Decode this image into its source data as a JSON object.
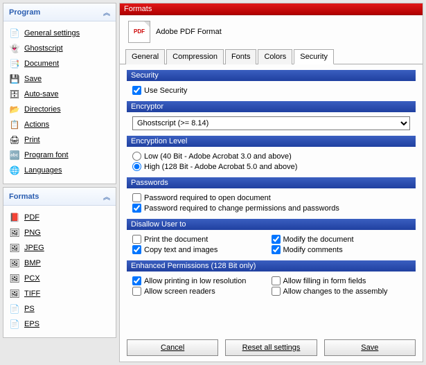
{
  "sidebar": {
    "program": {
      "title": "Program",
      "items": [
        {
          "label": "General settings",
          "icon": "📄"
        },
        {
          "label": "Ghostscript",
          "icon": "👻"
        },
        {
          "label": "Document",
          "icon": "📑"
        },
        {
          "label": "Save",
          "icon": "💾"
        },
        {
          "label": "Auto-save",
          "icon": "🗄"
        },
        {
          "label": "Directories",
          "icon": "📂"
        },
        {
          "label": "Actions",
          "icon": "📋"
        },
        {
          "label": "Print",
          "icon": "🖨"
        },
        {
          "label": "Program font",
          "icon": "🔤"
        },
        {
          "label": "Languages",
          "icon": "🌐"
        }
      ]
    },
    "formats": {
      "title": "Formats",
      "items": [
        {
          "label": "PDF",
          "icon": "📕"
        },
        {
          "label": "PNG",
          "icon": "🖼"
        },
        {
          "label": "JPEG",
          "icon": "🖼"
        },
        {
          "label": "BMP",
          "icon": "🖼"
        },
        {
          "label": "PCX",
          "icon": "🖼"
        },
        {
          "label": "TIFF",
          "icon": "🖼"
        },
        {
          "label": "PS",
          "icon": "📄"
        },
        {
          "label": "EPS",
          "icon": "📄"
        }
      ]
    }
  },
  "main": {
    "title": "Formats",
    "format_name": "Adobe PDF Format",
    "tabs": [
      "General",
      "Compression",
      "Fonts",
      "Colors",
      "Security"
    ],
    "active_tab": "Security",
    "security": {
      "hdr": "Security",
      "use_security": "Use Security",
      "use_security_checked": true
    },
    "encryptor": {
      "hdr": "Encryptor",
      "value": "Ghostscript (>= 8.14)"
    },
    "enc_level": {
      "hdr": "Encryption Level",
      "low": "Low (40 Bit - Adobe Acrobat 3.0 and above)",
      "high": "High (128 Bit - Adobe Acrobat 5.0 and above)",
      "selected": "high"
    },
    "passwords": {
      "hdr": "Passwords",
      "open": "Password required to open document",
      "open_checked": false,
      "change": "Password required to change permissions and passwords",
      "change_checked": true
    },
    "disallow": {
      "hdr": "Disallow User to",
      "print": "Print the document",
      "print_c": false,
      "copy": "Copy text and images",
      "copy_c": true,
      "modify": "Modify the document",
      "modify_c": true,
      "comments": "Modify comments",
      "comments_c": true
    },
    "enhanced": {
      "hdr": "Enhanced Permissions (128 Bit only)",
      "lowres": "Allow printing in low resolution",
      "lowres_c": true,
      "screen": "Allow screen readers",
      "screen_c": false,
      "form": "Allow filling in form fields",
      "form_c": false,
      "assembly": "Allow changes to the assembly",
      "assembly_c": false
    },
    "buttons": {
      "cancel": "Cancel",
      "reset": "Reset all settings",
      "save": "Save"
    }
  }
}
